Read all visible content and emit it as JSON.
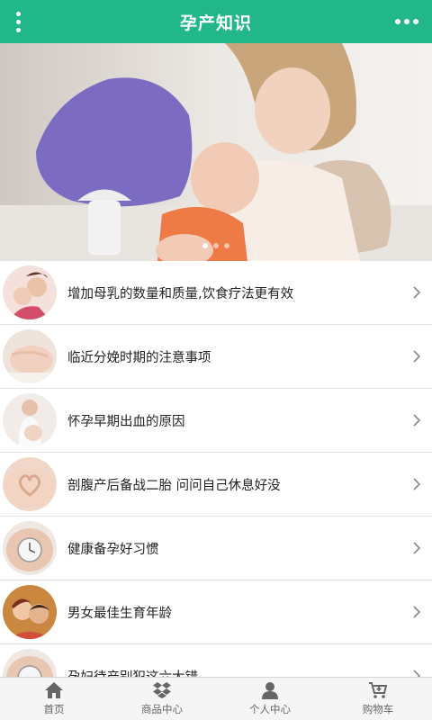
{
  "header": {
    "title": "孕产知识",
    "menu_icon": "vertical-dots-icon",
    "more_icon": "horizontal-dots-icon",
    "bg_color": "#21b788"
  },
  "banner": {
    "image": "mother-kissing-baby-photo",
    "slide_count": 3,
    "active_slide": 1
  },
  "articles": [
    {
      "title": "增加母乳的数量和质量,饮食疗法更有效",
      "thumb": "mother-baby"
    },
    {
      "title": "临近分娩时期的注意事项",
      "thumb": "pregnant-belly"
    },
    {
      "title": "怀孕早期出血的原因",
      "thumb": "pregnant-woman"
    },
    {
      "title": "剖腹产后备战二胎 问问自己休息好没",
      "thumb": "heart-hands-belly"
    },
    {
      "title": "健康备孕好习惯",
      "thumb": "clock-belly"
    },
    {
      "title": "男女最佳生育年龄",
      "thumb": "couple"
    },
    {
      "title": "孕妇待产别犯这六大错",
      "thumb": "clock-belly"
    }
  ],
  "tabbar": {
    "items": [
      {
        "label": "首页",
        "icon": "home-icon"
      },
      {
        "label": "商品中心",
        "icon": "dropbox-icon"
      },
      {
        "label": "个人中心",
        "icon": "user-icon"
      },
      {
        "label": "购物车",
        "icon": "cart-icon"
      }
    ]
  }
}
